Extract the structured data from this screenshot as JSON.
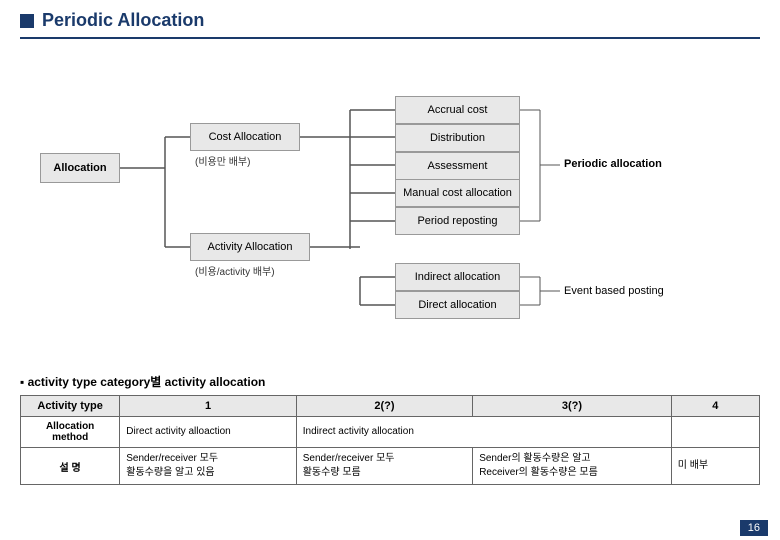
{
  "title": "Periodic Allocation",
  "diagram": {
    "allocationLabel": "Allocation",
    "costAllocationLabel": "Cost Allocation",
    "costAllocationSub": "(비용만 배부)",
    "activityAllocationLabel": "Activity Allocation",
    "activityAllocationSub": "(비용/activity 배부)",
    "rightBoxes": [
      "Accrual cost",
      "Distribution",
      "Assessment",
      "Manual cost allocation",
      "Period reposting",
      "Indirect allocation",
      "Direct allocation"
    ],
    "periodicAllocationLabel": "Periodic allocation",
    "eventBasedPostingLabel": "Event based posting"
  },
  "sectionLabel": "▪ activity type category별 activity allocation",
  "table": {
    "headers": [
      "Activity type",
      "1",
      "2(?)",
      "3(?)",
      "4"
    ],
    "rows": [
      {
        "col1": "Allocation method",
        "col2": "Direct activity alloaction",
        "col3": "Indirect activity allocation",
        "col4": "",
        "col5": ""
      },
      {
        "col1": "설  명",
        "col2": "Sender/receiver 모두\n활동수량을 알고 있음",
        "col3": "Sender/receiver 모두\n활동수량 모름",
        "col4": "Sender의 활동수량은 알고\nReceiver의 활동수량은 모름",
        "col5": "미 배부"
      }
    ]
  },
  "pageNumber": "16"
}
